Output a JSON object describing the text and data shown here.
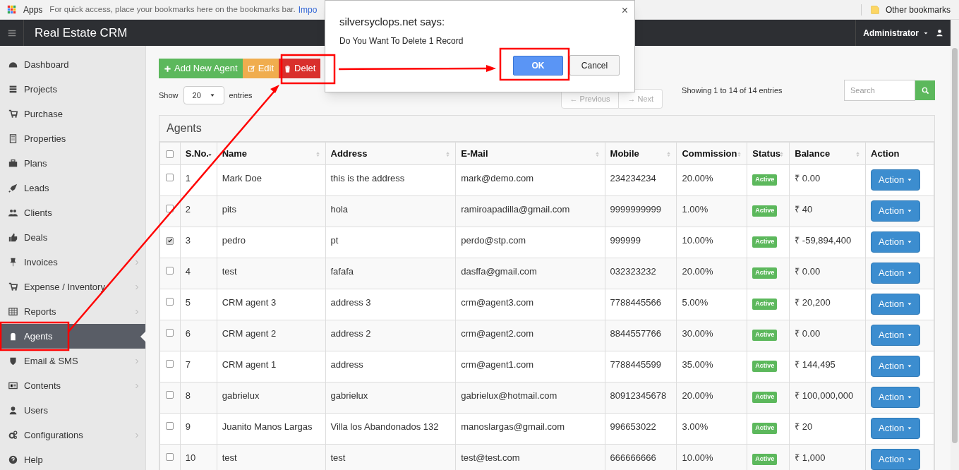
{
  "bookmarks_bar": {
    "apps": "Apps",
    "hint": "For quick access, place your bookmarks here on the bookmarks bar.",
    "import_link": "Impo",
    "other": "Other bookmarks"
  },
  "topbar": {
    "title": "Real Estate CRM",
    "user": "Administrator"
  },
  "sidebar": {
    "items": [
      {
        "label": "Dashboard",
        "selected": false,
        "submenu": false
      },
      {
        "label": "Projects",
        "selected": false,
        "submenu": false
      },
      {
        "label": "Purchase",
        "selected": false,
        "submenu": false
      },
      {
        "label": "Properties",
        "selected": false,
        "submenu": false
      },
      {
        "label": "Plans",
        "selected": false,
        "submenu": false
      },
      {
        "label": "Leads",
        "selected": false,
        "submenu": false
      },
      {
        "label": "Clients",
        "selected": false,
        "submenu": false
      },
      {
        "label": "Deals",
        "selected": false,
        "submenu": false
      },
      {
        "label": "Invoices",
        "selected": false,
        "submenu": true
      },
      {
        "label": "Expense / Inventory",
        "selected": false,
        "submenu": true
      },
      {
        "label": "Reports",
        "selected": false,
        "submenu": true
      },
      {
        "label": "Agents",
        "selected": true,
        "submenu": false
      },
      {
        "label": "Email & SMS",
        "selected": false,
        "submenu": true
      },
      {
        "label": "Contents",
        "selected": false,
        "submenu": true
      },
      {
        "label": "Users",
        "selected": false,
        "submenu": false
      },
      {
        "label": "Configurations",
        "selected": false,
        "submenu": true
      },
      {
        "label": "Help",
        "selected": false,
        "submenu": false
      }
    ]
  },
  "toolbar": {
    "buttons": [
      {
        "kind": "add",
        "label": "Add New Agent"
      },
      {
        "kind": "edit",
        "label": "Edit"
      },
      {
        "kind": "delete",
        "label": "Delet"
      }
    ],
    "show_label": "Show",
    "page_size": "20",
    "entries_label": "entries",
    "previous": "← Previous",
    "next": "→ Next",
    "info": "Showing 1 to 14 of 14 entries",
    "search_placeholder": "Search"
  },
  "table": {
    "title": "Agents",
    "select_all_checked": false,
    "columns": [
      "S.No.",
      "Name",
      "Address",
      "E-Mail",
      "Mobile",
      "Commission",
      "Status",
      "Balance",
      "Action"
    ],
    "rows": [
      {
        "checked": false,
        "cells": [
          "1",
          "Mark Doe",
          "this is the address",
          "mark@demo.com",
          "234234234",
          "20.00%",
          "Active",
          "₹ 0.00",
          "Action"
        ]
      },
      {
        "checked": false,
        "cells": [
          "2",
          "pits",
          "hola",
          "ramiroapadilla@gmail.com",
          "9999999999",
          "1.00%",
          "Active",
          "₹ 40",
          "Action"
        ]
      },
      {
        "checked": true,
        "cells": [
          "3",
          "pedro",
          "pt",
          "perdo@stp.com",
          "999999",
          "10.00%",
          "Active",
          "₹ -59,894,400",
          "Action"
        ]
      },
      {
        "checked": false,
        "cells": [
          "4",
          "test",
          "fafafa",
          "dasffa@gmail.com",
          "032323232",
          "20.00%",
          "Active",
          "₹ 0.00",
          "Action"
        ]
      },
      {
        "checked": false,
        "cells": [
          "5",
          "CRM agent 3",
          "address 3",
          "crm@agent3.com",
          "7788445566",
          "5.00%",
          "Active",
          "₹ 20,200",
          "Action"
        ]
      },
      {
        "checked": false,
        "cells": [
          "6",
          "CRM agent 2",
          "address 2",
          "crm@agent2.com",
          "8844557766",
          "30.00%",
          "Active",
          "₹ 0.00",
          "Action"
        ]
      },
      {
        "checked": false,
        "cells": [
          "7",
          "CRM agent 1",
          "address",
          "crm@agent1.com",
          "7788445599",
          "35.00%",
          "Active",
          "₹ 144,495",
          "Action"
        ]
      },
      {
        "checked": false,
        "cells": [
          "8",
          "gabrielux",
          "gabrielux",
          "gabrielux@hotmail.com",
          "80912345678",
          "20.00%",
          "Active",
          "₹ 100,000,000",
          "Action"
        ]
      },
      {
        "checked": false,
        "cells": [
          "9",
          "Juanito Manos Largas",
          "Villa los Abandonados 132",
          "manoslargas@gmail.com",
          "996653022",
          "3.00%",
          "Active",
          "₹ 20",
          "Action"
        ]
      },
      {
        "checked": false,
        "cells": [
          "10",
          "test",
          "test",
          "test@test.com",
          "666666666",
          "10.00%",
          "Active",
          "₹ 1,000",
          "Action"
        ]
      }
    ]
  },
  "dialog": {
    "title": "silversyclops.net says:",
    "message": "Do You Want To Delete 1 Record",
    "close": "×",
    "ok": "OK",
    "cancel": "Cancel"
  }
}
